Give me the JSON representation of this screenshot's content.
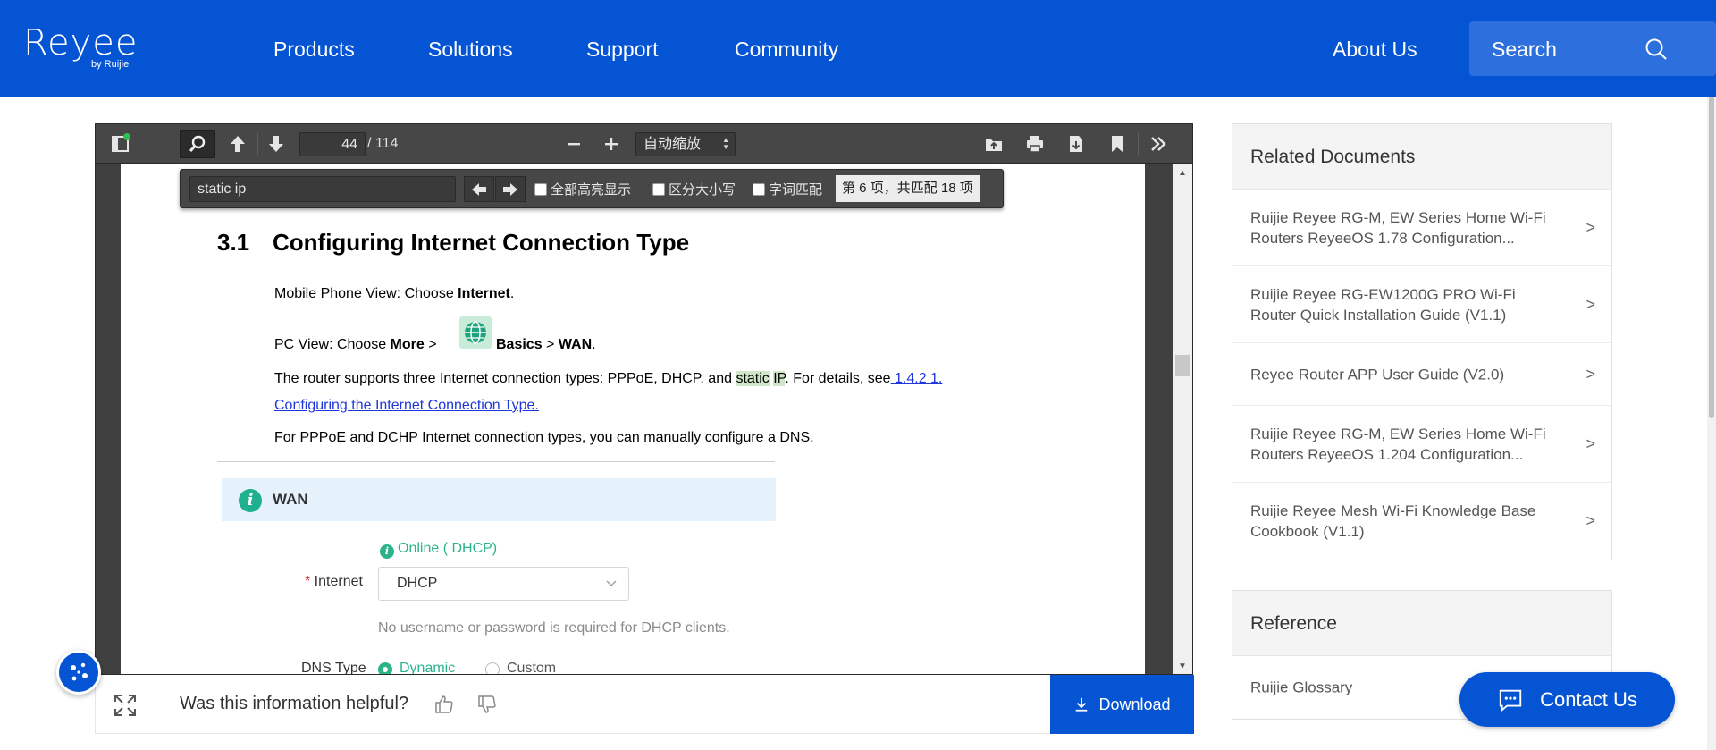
{
  "header": {
    "logo_text": "Reyee",
    "logo_sub": "by Ruijie",
    "nav": [
      "Products",
      "Solutions",
      "Support",
      "Community"
    ],
    "about": "About Us",
    "search_label": "Search"
  },
  "pdf_viewer": {
    "current_page": "44",
    "total_pages": "/ 114",
    "zoom": "自动缩放",
    "find": {
      "query": "static ip",
      "highlight_all": "全部高亮显示",
      "match_case": "区分大小写",
      "whole_words": "字词匹配",
      "result": "第 6 项，共匹配 18 项"
    },
    "page": {
      "section_number": "3.1",
      "section_title": "Configuring Internet Connection Type",
      "line1_pre": "Mobile Phone View: Choose ",
      "line1_bold": "Internet",
      "line1_post": ".",
      "line2_pre": "PC View: Choose ",
      "line2_more": "More",
      "line2_gt1": " > ",
      "line2_basics": "Basics",
      "line2_gt2": " > ",
      "line2_wan": "WAN",
      "line2_post": ".",
      "line3_pre": "The router supports three Internet connection types: PPPoE, DHCP, and ",
      "line3_hl1": "static",
      "line3_space": " ",
      "line3_hl2": "IP",
      "line3_mid": ". For details, see",
      "line3_link": " 1.4.2    1.",
      "line4_link": "Configuring the Internet Connection Type.",
      "line5": "For PPPoE and DCHP Internet connection types, you can manually configure a DNS.",
      "wan_title": "WAN",
      "status": "Online ( DHCP)",
      "internet_label_req": "* ",
      "internet_label": "Internet",
      "internet_value": "DHCP",
      "dhcp_hint": "No username or password is required for DHCP clients.",
      "dns_label": "DNS Type",
      "dns_opt1": "Dynamic",
      "dns_opt2": "Custom"
    }
  },
  "feedback": {
    "question": "Was this information helpful?",
    "download": "Download"
  },
  "sidebar": {
    "related_title": "Related Documents",
    "related": [
      "Ruijie Reyee RG-M, EW Series Home Wi-Fi Routers ReyeeOS 1.78 Configuration...",
      "Ruijie Reyee RG-EW1200G PRO Wi-Fi Router Quick Installation Guide (V1.1)",
      "Reyee Router APP User Guide (V2.0)",
      "Ruijie Reyee RG-M, EW Series Home Wi-Fi Routers ReyeeOS 1.204 Configuration...",
      "Ruijie Reyee Mesh Wi-Fi Knowledge Base Cookbook (V1.1)"
    ],
    "chevron": ">",
    "reference_title": "Reference",
    "reference": [
      "Ruijie Glossary"
    ]
  },
  "contact": "Contact Us",
  "colors": {
    "brand": "#0554d3",
    "highlight": "#cfe6c8",
    "success": "#2bb38a"
  }
}
